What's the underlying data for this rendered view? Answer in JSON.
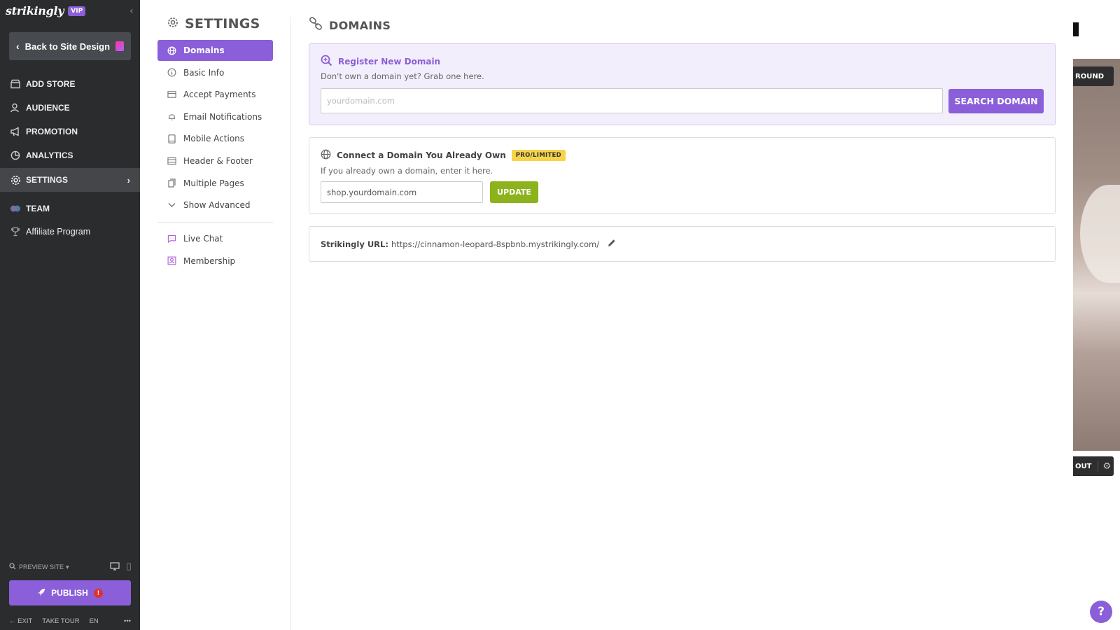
{
  "brand": {
    "name": "strikingly",
    "badge": "VIP"
  },
  "sidebar": {
    "back_label": "Back to Site Design",
    "items": [
      {
        "label": "ADD STORE",
        "icon": "store-icon"
      },
      {
        "label": "AUDIENCE",
        "icon": "users-icon"
      },
      {
        "label": "PROMOTION",
        "icon": "megaphone-icon"
      },
      {
        "label": "ANALYTICS",
        "icon": "pie-chart-icon"
      },
      {
        "label": "SETTINGS",
        "icon": "gear-icon",
        "active": true
      },
      {
        "label": "TEAM",
        "icon": "team-icon"
      },
      {
        "label": "Affiliate Program",
        "icon": "trophy-icon"
      }
    ],
    "preview_site": "PREVIEW SITE",
    "publish_label": "PUBLISH",
    "publish_alert": "!",
    "footer": {
      "exit": "EXIT",
      "take_tour": "TAKE TOUR",
      "lang": "EN",
      "more": "•••"
    }
  },
  "settings": {
    "title": "SETTINGS",
    "nav": [
      {
        "label": "Domains",
        "icon": "globe-icon",
        "active": true
      },
      {
        "label": "Basic Info",
        "icon": "info-icon"
      },
      {
        "label": "Accept Payments",
        "icon": "credit-card-icon"
      },
      {
        "label": "Email Notifications",
        "icon": "bell-icon"
      },
      {
        "label": "Mobile Actions",
        "icon": "mobile-icon"
      },
      {
        "label": "Header & Footer",
        "icon": "layout-icon"
      },
      {
        "label": "Multiple Pages",
        "icon": "pages-icon"
      },
      {
        "label": "Show Advanced",
        "icon": "chevron-down-icon"
      }
    ],
    "extra_nav": [
      {
        "label": "Live Chat",
        "icon": "chat-icon"
      },
      {
        "label": "Membership",
        "icon": "member-icon"
      }
    ]
  },
  "domains": {
    "title": "DOMAINS",
    "register": {
      "heading": "Register New Domain",
      "subtext": "Don't own a domain yet? Grab one here.",
      "placeholder": "yourdomain.com",
      "button": "SEARCH DOMAIN"
    },
    "connect": {
      "heading": "Connect a Domain You Already Own",
      "badge": "PRO/LIMITED",
      "subtext": "If you already own a domain, enter it here.",
      "value": "shop.yourdomain.com",
      "button": "UPDATE"
    },
    "url": {
      "label": "Strikingly URL:",
      "value": "https://cinnamon-leopard-8spbnb.mystrikingly.com/"
    }
  },
  "preview": {
    "pill_top": "ROUND",
    "pill_bottom": "OUT",
    "help": "?"
  },
  "colors": {
    "accent": "#8a5fd9",
    "sidebar_bg": "#2b2c2e",
    "update_green": "#8cb31d",
    "badge_yellow": "#f6d44a"
  }
}
